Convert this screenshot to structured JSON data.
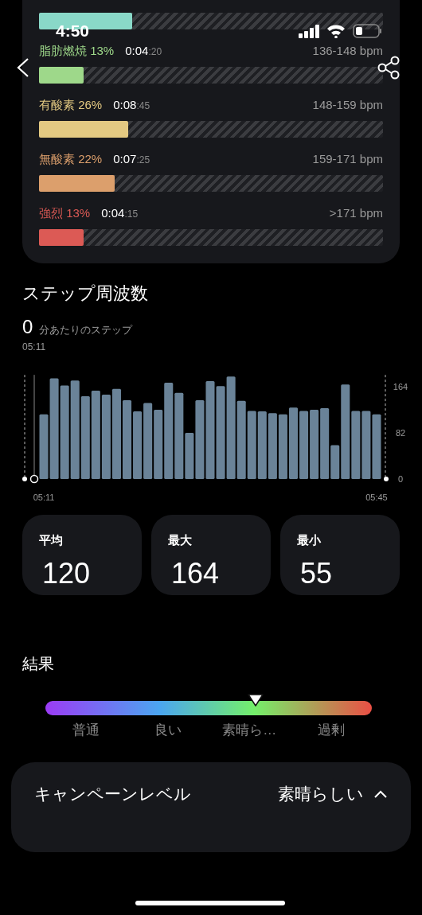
{
  "status_bar": {
    "time": "4:50"
  },
  "zones": [
    {
      "color": "#89d8c8",
      "level": 0.27
    },
    {
      "label": "脂肪燃焼 13%",
      "time": "0:04",
      "seconds": ":20",
      "range": "136-148 bpm",
      "color": "#9ed88a",
      "level": 0.13
    },
    {
      "label": "有酸素 26%",
      "time": "0:08",
      "seconds": ":45",
      "range": "148-159 bpm",
      "color": "#e3c982",
      "level": 0.26
    },
    {
      "label": "無酸素 22%",
      "time": "0:07",
      "seconds": ":25",
      "range": "159-171 bpm",
      "color": "#dc9f6c",
      "level": 0.22
    },
    {
      "label": "強烈 13%",
      "time": "0:04",
      "seconds": ":15",
      "range": ">171 bpm",
      "color": "#dc5a55",
      "level": 0.13
    }
  ],
  "cadence": {
    "title": "ステップ周波数",
    "value": "0",
    "unit": "分あたりのステップ",
    "time": "05:11",
    "chart_data": {
      "type": "bar",
      "categories": [
        "05:11",
        null,
        null,
        null,
        null,
        null,
        null,
        null,
        null,
        null,
        null,
        null,
        null,
        null,
        null,
        null,
        null,
        null,
        null,
        null,
        null,
        null,
        null,
        null,
        null,
        null,
        null,
        null,
        null,
        null,
        null,
        null,
        "05:45"
      ],
      "values": [
        115,
        179,
        166,
        175,
        147,
        157,
        150,
        160,
        140,
        120,
        135,
        123,
        171,
        153,
        82,
        140,
        174,
        165,
        182,
        139,
        121,
        120,
        117,
        115,
        127,
        121,
        123,
        126,
        60,
        168,
        121,
        121,
        115
      ],
      "ylim": [
        0,
        185
      ],
      "yticks": [
        0,
        82,
        164
      ]
    }
  },
  "stats": [
    {
      "label": "平均",
      "value": "120"
    },
    {
      "label": "最大",
      "value": "164"
    },
    {
      "label": "最小",
      "value": "55"
    }
  ],
  "result": {
    "title": "結果",
    "level": 0.645,
    "scale": [
      "普通",
      "良い",
      "素晴ら…",
      "過剰"
    ]
  },
  "campaign": {
    "title": "キャンペーンレベル",
    "value": "素晴らしい"
  }
}
